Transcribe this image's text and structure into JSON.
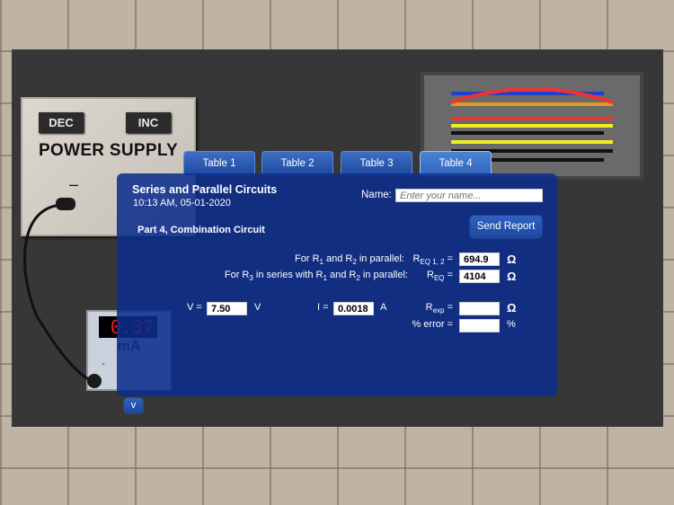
{
  "power_supply": {
    "title": "POWER SUPPLY",
    "dec": "DEC",
    "inc": "INC",
    "minus": "–",
    "plus": "+"
  },
  "ammeter": {
    "reading": "0.37",
    "unit": "mA",
    "minus": "-",
    "plus": "+"
  },
  "tabs": [
    "Table 1",
    "Table 2",
    "Table 3",
    "Table 4"
  ],
  "active_tab": 3,
  "panel": {
    "title": "Series and Parallel Circuits",
    "timestamp": "10:13 AM, 05-01-2020",
    "part": "Part 4, Combination Circuit",
    "name_label": "Name:",
    "name_placeholder": "Enter your name...",
    "name_value": "",
    "send_report": "Send Report",
    "row1_label": [
      "For R",
      "1",
      " and R",
      "2",
      " in parallel:"
    ],
    "req12_label": [
      "R",
      "EQ 1, 2",
      " ="
    ],
    "req12_value": "694.9",
    "row2_label": [
      "For R",
      "3",
      " in series with R",
      "1",
      " and R",
      "2",
      " in parallel:"
    ],
    "req_label": [
      "R",
      "EQ",
      " ="
    ],
    "req_value": "4104",
    "ohm": "Ω",
    "v_label": "V =",
    "v_value": "7.50",
    "v_unit": "V",
    "i_label": "I =",
    "i_value": "0.0018",
    "i_unit": "A",
    "rexp_label": [
      "R",
      "exp",
      " ="
    ],
    "rexp_value": "",
    "err_label": "% error =",
    "err_value": "",
    "err_unit": "%"
  },
  "collapse_button": "v"
}
